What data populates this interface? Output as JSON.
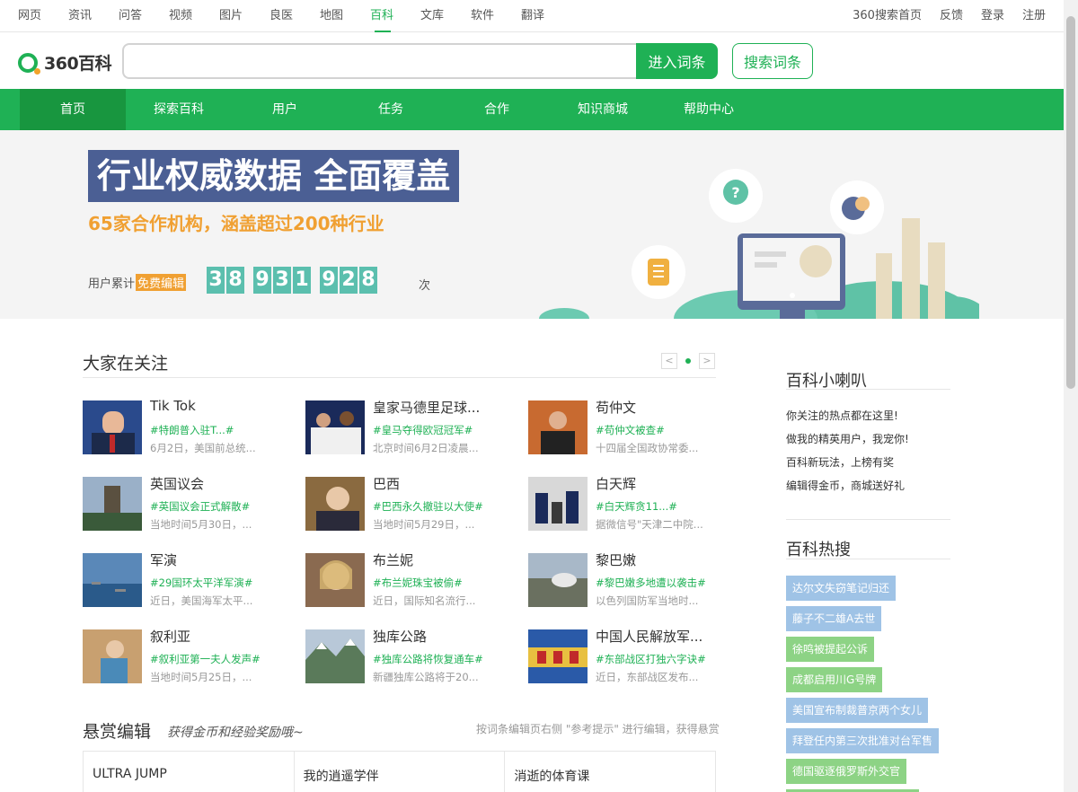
{
  "topnav": {
    "left": [
      "网页",
      "资讯",
      "问答",
      "视频",
      "图片",
      "良医",
      "地图",
      "百科",
      "文库",
      "软件",
      "翻译"
    ],
    "active_index": 7,
    "right": [
      "360搜索首页",
      "反馈",
      "登录",
      "注册"
    ]
  },
  "logo": {
    "text": "360百科"
  },
  "search": {
    "placeholder": "",
    "value": "",
    "enter_label": "进入词条",
    "search_label": "搜索词条"
  },
  "greennav": [
    "首页",
    "探索百科",
    "用户",
    "任务",
    "合作",
    "知识商城",
    "帮助中心"
  ],
  "banner": {
    "headline": "行业权威数据 全面覆盖",
    "subline": "65家合作机构，涵盖超过200种行业",
    "counter_prefix": "用户累计",
    "counter_free": "免费编辑",
    "digits": [
      "3",
      "8",
      "9",
      "3",
      "1",
      "9",
      "2",
      "8"
    ],
    "counter_unit": "次"
  },
  "focus": {
    "title": "大家在关注",
    "pager": {
      "prev": "<",
      "next": ">"
    },
    "cards": [
      {
        "name": "Tik Tok",
        "tag": "#特朗普入驻T...#",
        "desc": "6月2日，美国前总统..."
      },
      {
        "name": "皇家马德里足球...",
        "tag": "#皇马夺得欧冠冠军#",
        "desc": "北京时间6月2日凌晨..."
      },
      {
        "name": "苟仲文",
        "tag": "#苟仲文被查#",
        "desc": "十四届全国政协常委..."
      },
      {
        "name": "英国议会",
        "tag": "#英国议会正式解散#",
        "desc": "当地时间5月30日，..."
      },
      {
        "name": "巴西",
        "tag": "#巴西永久撤驻以大使#",
        "desc": "当地时间5月29日，..."
      },
      {
        "name": "白天辉",
        "tag": "#白天辉贪11...#",
        "desc": "据微信号\"天津二中院..."
      },
      {
        "name": "军演",
        "tag": "#29国环太平洋军演#",
        "desc": "近日，美国海军太平..."
      },
      {
        "name": "布兰妮",
        "tag": "#布兰妮珠宝被偷#",
        "desc": "近日，国际知名流行..."
      },
      {
        "name": "黎巴嫩",
        "tag": "#黎巴嫩多地遭以袭击#",
        "desc": "以色列国防军当地时..."
      },
      {
        "name": "叙利亚",
        "tag": "#叙利亚第一夫人发声#",
        "desc": "当地时间5月25日，..."
      },
      {
        "name": "独库公路",
        "tag": "#独库公路将恢复通车#",
        "desc": "新疆独库公路将于20..."
      },
      {
        "name": "中国人民解放军...",
        "tag": "#东部战区打独六字诀#",
        "desc": "近日，东部战区发布..."
      }
    ]
  },
  "bounty": {
    "title": "悬赏编辑",
    "slogan": "获得金币和经验奖励哦~",
    "hint": "按词条编辑页右侧 \"参考提示\" 进行编辑，获得悬赏",
    "items": [
      "ULTRA JUMP",
      "我的逍遥学伴",
      "消逝的体育课"
    ]
  },
  "sidebar": {
    "news_title": "百科小喇叭",
    "news": [
      "你关注的热点都在这里!",
      "做我的精英用户，我宠你!",
      "百科新玩法，上榜有奖",
      "编辑得金币，商城送好礼"
    ],
    "hot_title": "百科热搜",
    "hot": [
      "达尔文失窃笔记归还",
      "藤子不二雄A去世",
      "徐鸣被提起公诉",
      "成都启用川G号牌",
      "美国宣布制裁普京两个女儿",
      "拜登任内第三次批准对台军售",
      "德国驱逐俄罗斯外交官"
    ]
  }
}
